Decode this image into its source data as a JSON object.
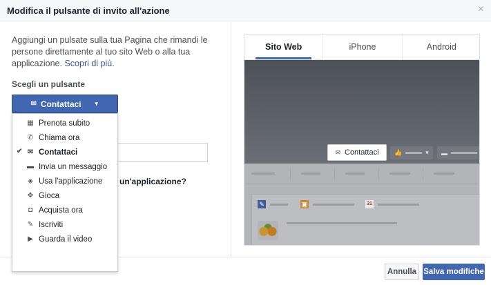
{
  "dialog": {
    "title": "Modifica il pulsante di invito all'azione",
    "close_icon": "×"
  },
  "left": {
    "description": "Aggiungi un pulsate sulla tua Pagina che rimandi le persone direttamente al tuo sito Web o alla tua applicazione.",
    "learn_more": "Scopri di più.",
    "section_label": "Scegli un pulsante",
    "selected_button": "Contattaci",
    "hidden_question": "un'applicazione?",
    "menu": [
      {
        "label": "Prenota subito",
        "icon": "calendar-icon",
        "glyph": "▦"
      },
      {
        "label": "Chiama ora",
        "icon": "phone-icon",
        "glyph": "✆"
      },
      {
        "label": "Contattaci",
        "icon": "mail-icon",
        "glyph": "✉",
        "selected": true,
        "check": "✔"
      },
      {
        "label": "Invia un messaggio",
        "icon": "chat-bubble-icon",
        "glyph": "▬"
      },
      {
        "label": "Usa l'applicazione",
        "icon": "cube-icon",
        "glyph": "◈"
      },
      {
        "label": "Gioca",
        "icon": "gamepad-icon",
        "glyph": "✥"
      },
      {
        "label": "Acquista ora",
        "icon": "shopping-bag-icon",
        "glyph": "◘"
      },
      {
        "label": "Iscriviti",
        "icon": "pencil-icon",
        "glyph": "✎"
      },
      {
        "label": "Guarda il video",
        "icon": "play-icon",
        "glyph": "▶"
      }
    ]
  },
  "preview": {
    "tabs": [
      {
        "label": "Sito Web",
        "active": true
      },
      {
        "label": "iPhone",
        "active": false
      },
      {
        "label": "Android",
        "active": false
      }
    ],
    "cta_label": "Contattaci",
    "cta_icon": "✉",
    "like_icon": "👍",
    "like_caret": "▾",
    "message_icon": "▬",
    "composer_icons": [
      "✎",
      "▣",
      "31"
    ]
  },
  "footer": {
    "cancel": "Annulla",
    "save": "Salva modifiche"
  },
  "colors": {
    "accent": "#4267b2",
    "header_bg": "#f6f7f9",
    "link": "#365899"
  }
}
